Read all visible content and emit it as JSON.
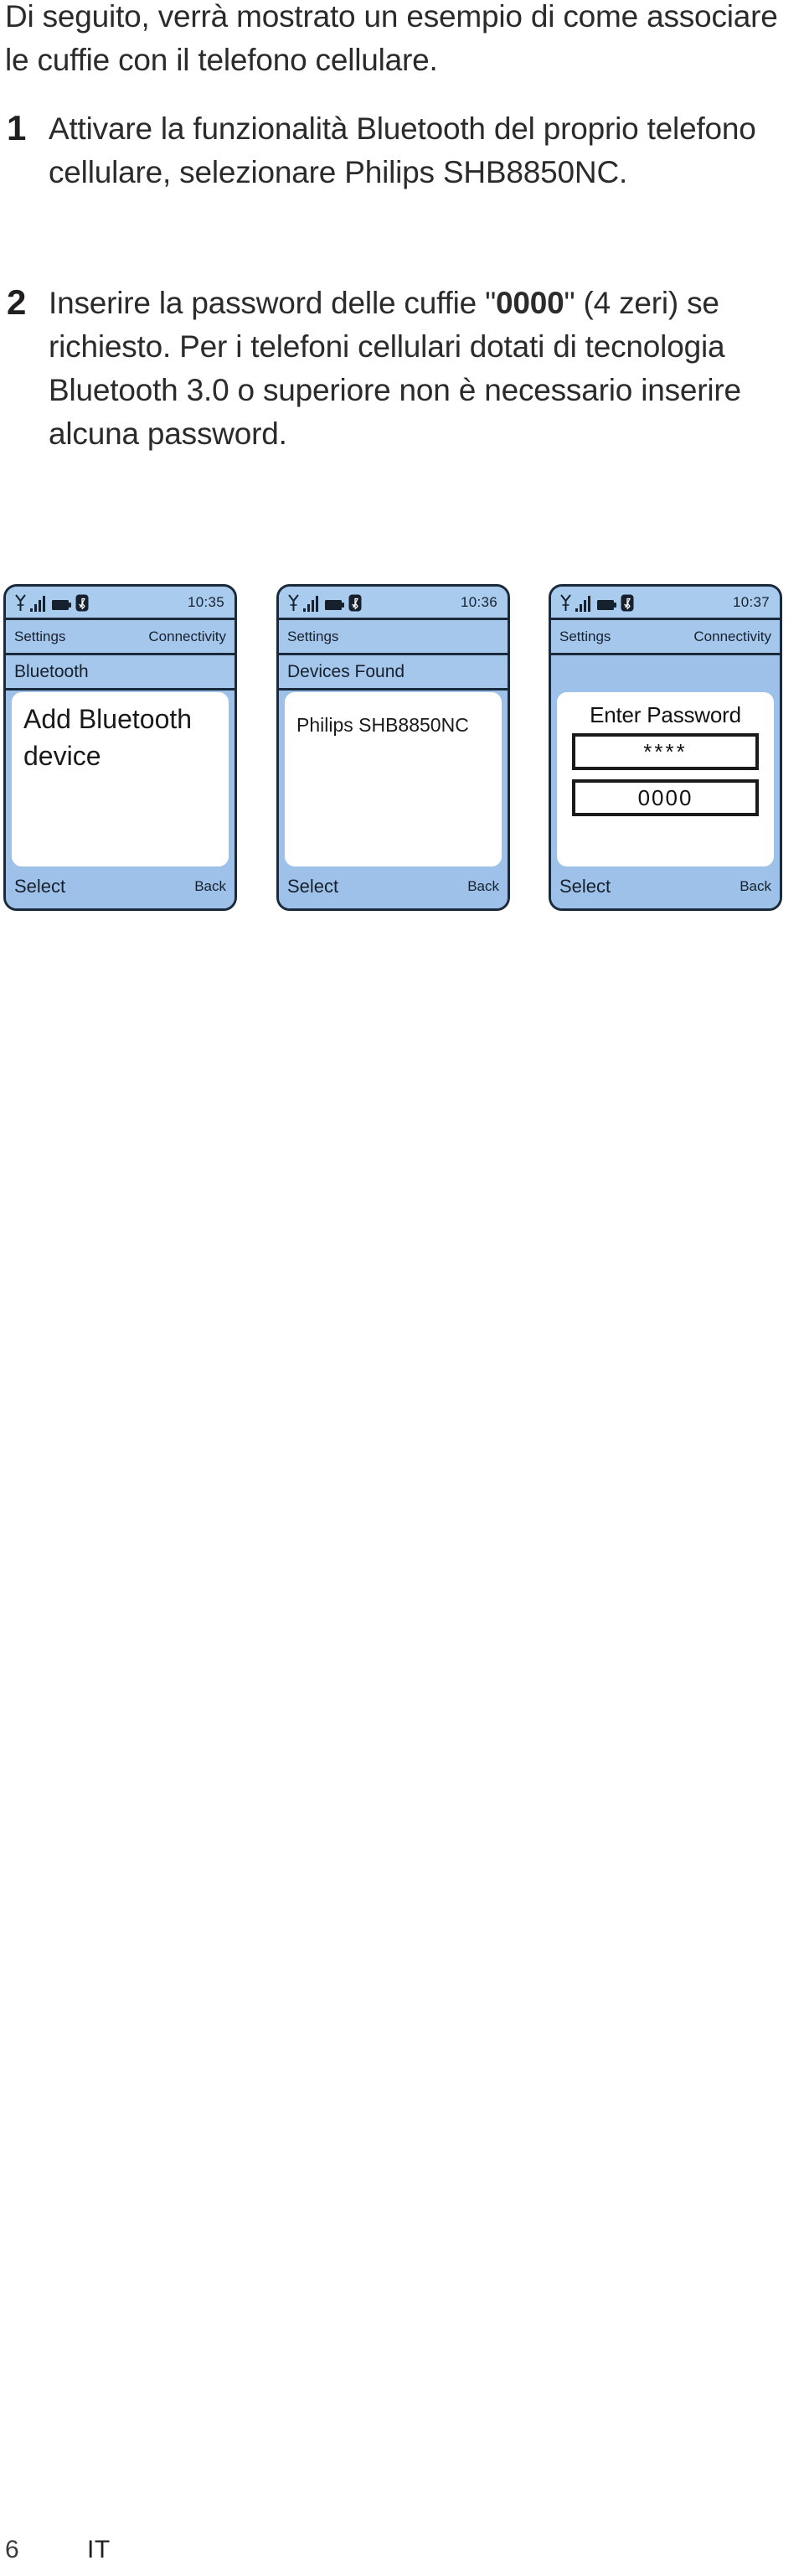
{
  "document": {
    "intro_paragraph": "Di seguito, verrà mostrato un esempio di come associare le cuffie con il telefono cellulare.",
    "steps": [
      {
        "number": "1",
        "text": "Attivare la funzionalità Bluetooth del proprio telefono cellulare, selezionare Philips SHB8850NC."
      },
      {
        "number": "2",
        "text_before": "Inserire la password delle cuffie \"",
        "bold_value": "0000",
        "text_after": "\" (4 zeri) se richiesto. Per i telefoni cellulari dotati di tecnologia Bluetooth 3.0 o superiore non è necessario inserire alcuna password."
      }
    ],
    "footer": {
      "page_number": "6",
      "language_code": "IT"
    }
  },
  "colors": {
    "phone_outline": "#1b2a3a",
    "phone_screen_blue": "#9dc1e8",
    "phone_bar_blue": "#a5c7ec",
    "phone_status_blue": "#a9cbee",
    "card_white": "#ffffff",
    "text_dark": "#17212e",
    "body_text": "#2b2b2b"
  },
  "phones": [
    {
      "id": "phone-1",
      "status": {
        "icons": [
          "signal-antenna-icon",
          "signal-bars-icon",
          "battery-icon",
          "bluetooth-icon"
        ],
        "time": "10:35"
      },
      "path_left": "Settings",
      "path_right": "Connectivity",
      "title": "Bluetooth",
      "content_type": "menu",
      "menu_text": "Add Bluetooth device",
      "softkey_left": "Select",
      "softkey_right": "Back"
    },
    {
      "id": "phone-2",
      "status": {
        "icons": [
          "signal-antenna-icon",
          "signal-bars-icon",
          "battery-icon",
          "bluetooth-icon"
        ],
        "time": "10:36"
      },
      "path_left": "Settings",
      "path_right": "",
      "title": "Devices Found",
      "content_type": "device-list",
      "device_name": "Philips SHB8850NC",
      "softkey_left": "Select",
      "softkey_right": "Back"
    },
    {
      "id": "phone-3",
      "status": {
        "icons": [
          "signal-antenna-icon",
          "signal-bars-icon",
          "battery-icon",
          "bluetooth-icon"
        ],
        "time": "10:37"
      },
      "path_left": "Settings",
      "path_right": "Connectivity",
      "title": "",
      "content_type": "password",
      "password_title": "Enter Password",
      "password_masked": "****",
      "password_plain": "0000",
      "softkey_left": "Select",
      "softkey_right": "Back"
    }
  ]
}
